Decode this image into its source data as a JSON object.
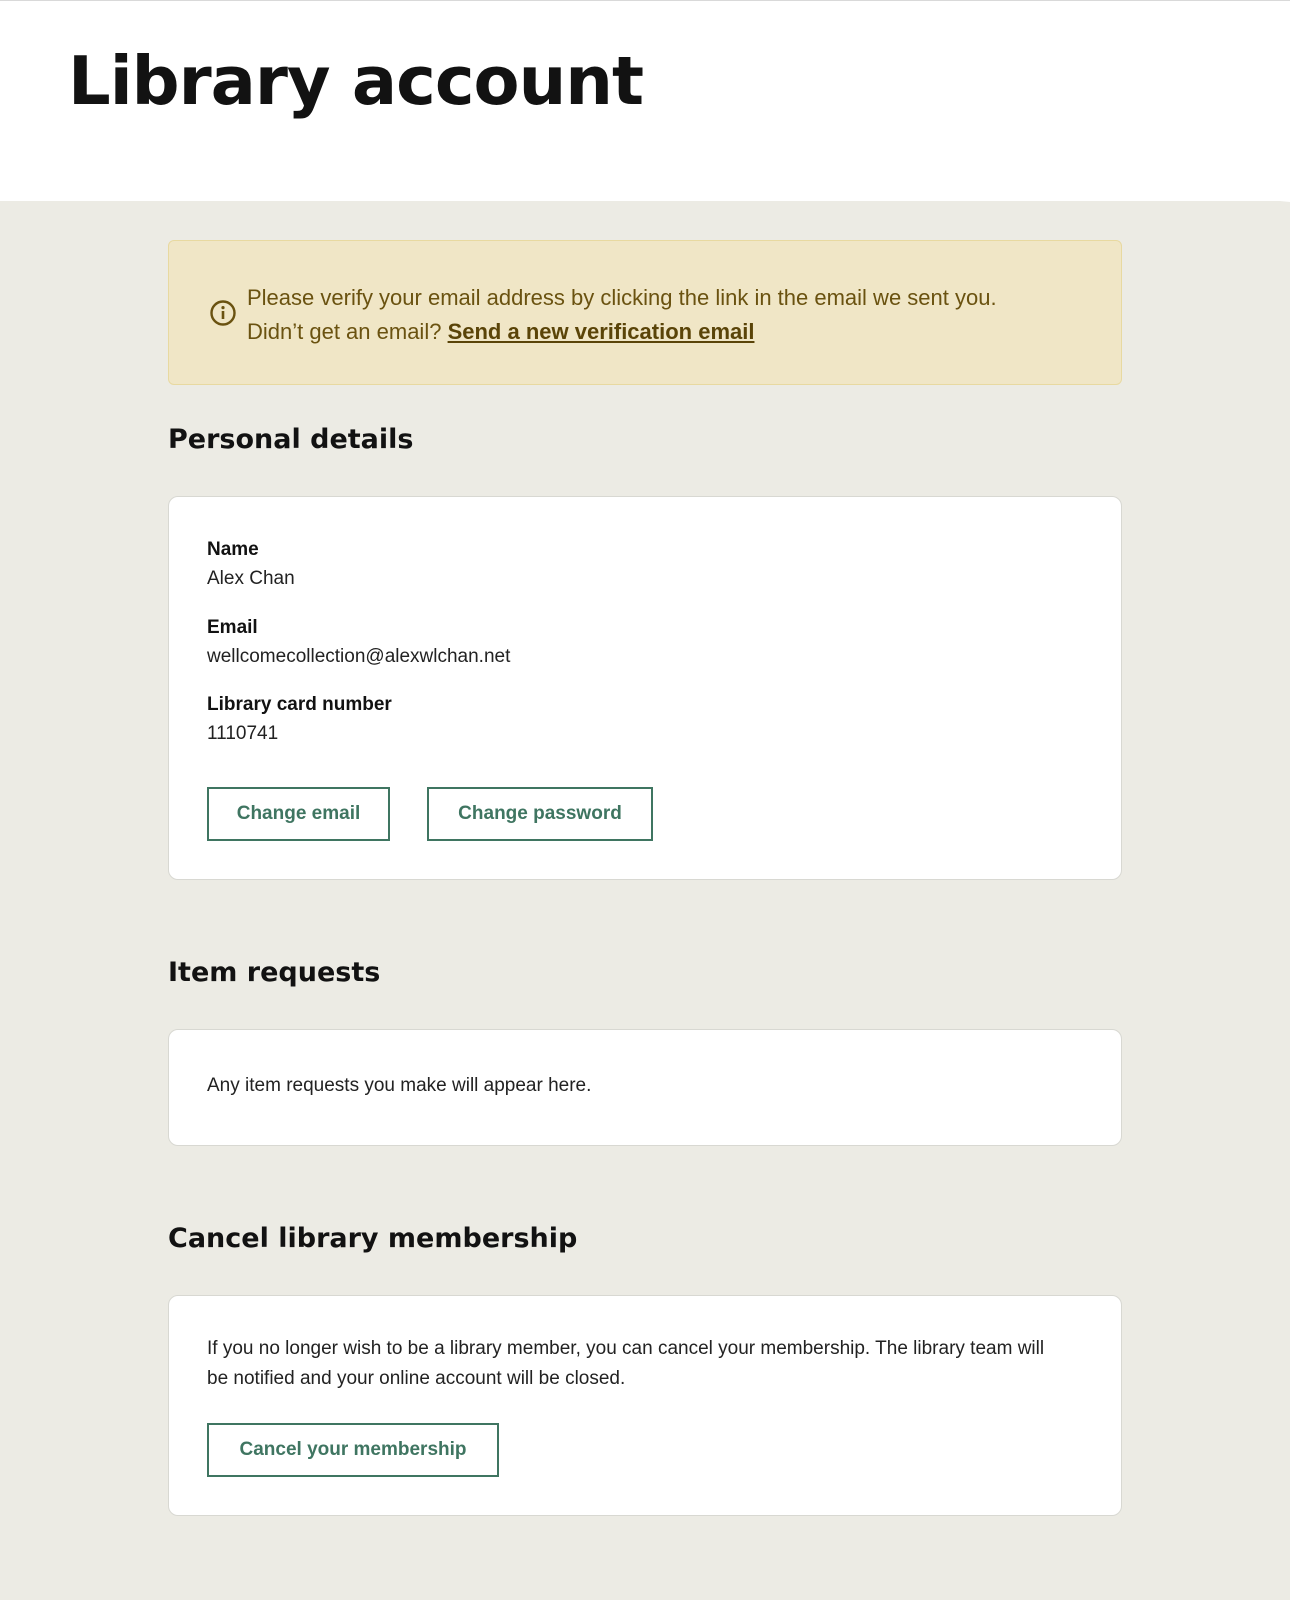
{
  "header": {
    "title": "Library account"
  },
  "notice": {
    "icon": "info-circle-icon",
    "line1": "Please verify your email address by clicking the link in the email we sent you.",
    "line2_prefix": "Didn’t get an email?",
    "link_label": "Send a new verification email"
  },
  "personal_details": {
    "heading": "Personal details",
    "fields": [
      {
        "label": "Name",
        "value": "Alex Chan"
      },
      {
        "label": "Email",
        "value": "wellcomecollection@alexwlchan.net"
      },
      {
        "label": "Library card number",
        "value": "1110741"
      }
    ],
    "change_email_label": "Change email",
    "change_password_label": "Change password"
  },
  "item_requests": {
    "heading": "Item requests",
    "empty_text": "Any item requests you make will appear here."
  },
  "cancel_membership": {
    "heading": "Cancel library membership",
    "text": "If you no longer wish to be a library member, you can cancel your membership. The library team will be notified and your online account will be closed.",
    "button_label": "Cancel your membership"
  },
  "colors": {
    "accent": "#3f7561",
    "notice_bg": "#f0e6c6",
    "page_bg": "#ecebe4"
  }
}
